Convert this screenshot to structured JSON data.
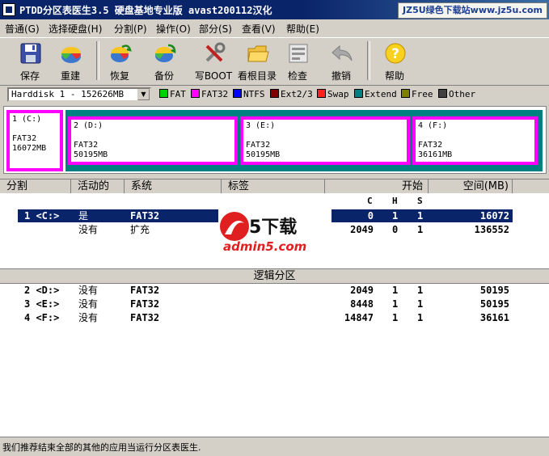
{
  "title": "PTDD分区表医生3.5 硬盘基地专业版 avast200112汉化",
  "watermark": "JZ5U绿色下载站www.jz5u.com",
  "menu": [
    "普通(G)",
    "选择硬盘(H)",
    "分割(P)",
    "操作(O)",
    "部分(S)",
    "查看(V)",
    "帮助(E)"
  ],
  "toolbar": [
    "保存",
    "重建",
    "恢复",
    "备份",
    "写BOOT",
    "看根目录",
    "检查",
    "撤销",
    "帮助"
  ],
  "disk_select": "Harddisk 1 - 152626MB",
  "legend": [
    {
      "label": "FAT",
      "color": "#00d000"
    },
    {
      "label": "FAT32",
      "color": "#ff00ff"
    },
    {
      "label": "NTFS",
      "color": "#0000ff"
    },
    {
      "label": "Ext2/3",
      "color": "#800000"
    },
    {
      "label": "Swap",
      "color": "#ff2020"
    },
    {
      "label": "Extend",
      "color": "#008080"
    },
    {
      "label": "Free",
      "color": "#808000"
    },
    {
      "label": "Other",
      "color": "#404040"
    }
  ],
  "partitions": [
    {
      "label": "1 (C:)",
      "fs": "FAT32",
      "size": "16072MB"
    },
    {
      "label": "2 (D:)",
      "fs": "FAT32",
      "size": "50195MB"
    },
    {
      "label": "3 (E:)",
      "fs": "FAT32",
      "size": "50195MB"
    },
    {
      "label": "4 (F:)",
      "fs": "FAT32",
      "size": "36161MB"
    }
  ],
  "headers": [
    "分割",
    "活动的",
    "系统",
    "标签",
    "开始",
    "空间(MB)"
  ],
  "chs": [
    "C",
    "H",
    "S"
  ],
  "primary_rows": [
    {
      "part": "1 <C:>",
      "active": "是",
      "system": "FAT32",
      "c": "0",
      "h": "1",
      "s": "1",
      "size": "16072"
    },
    {
      "part": "",
      "active": "没有",
      "system": "扩充",
      "c": "2049",
      "h": "0",
      "s": "1",
      "size": "136552"
    }
  ],
  "logical_header": "逻辑分区",
  "logical_rows": [
    {
      "part": "2 <D:>",
      "active": "没有",
      "system": "FAT32",
      "c": "2049",
      "h": "1",
      "s": "1",
      "size": "50195"
    },
    {
      "part": "3 <E:>",
      "active": "没有",
      "system": "FAT32",
      "c": "8448",
      "h": "1",
      "s": "1",
      "size": "50195"
    },
    {
      "part": "4 <F:>",
      "active": "没有",
      "system": "FAT32",
      "c": "14847",
      "h": "1",
      "s": "1",
      "size": "36161"
    }
  ],
  "logo_text": {
    "brand": "5下载",
    "url": "admin5.com"
  },
  "status": "我们推荐结束全部的其他的应用当运行分区表医生."
}
